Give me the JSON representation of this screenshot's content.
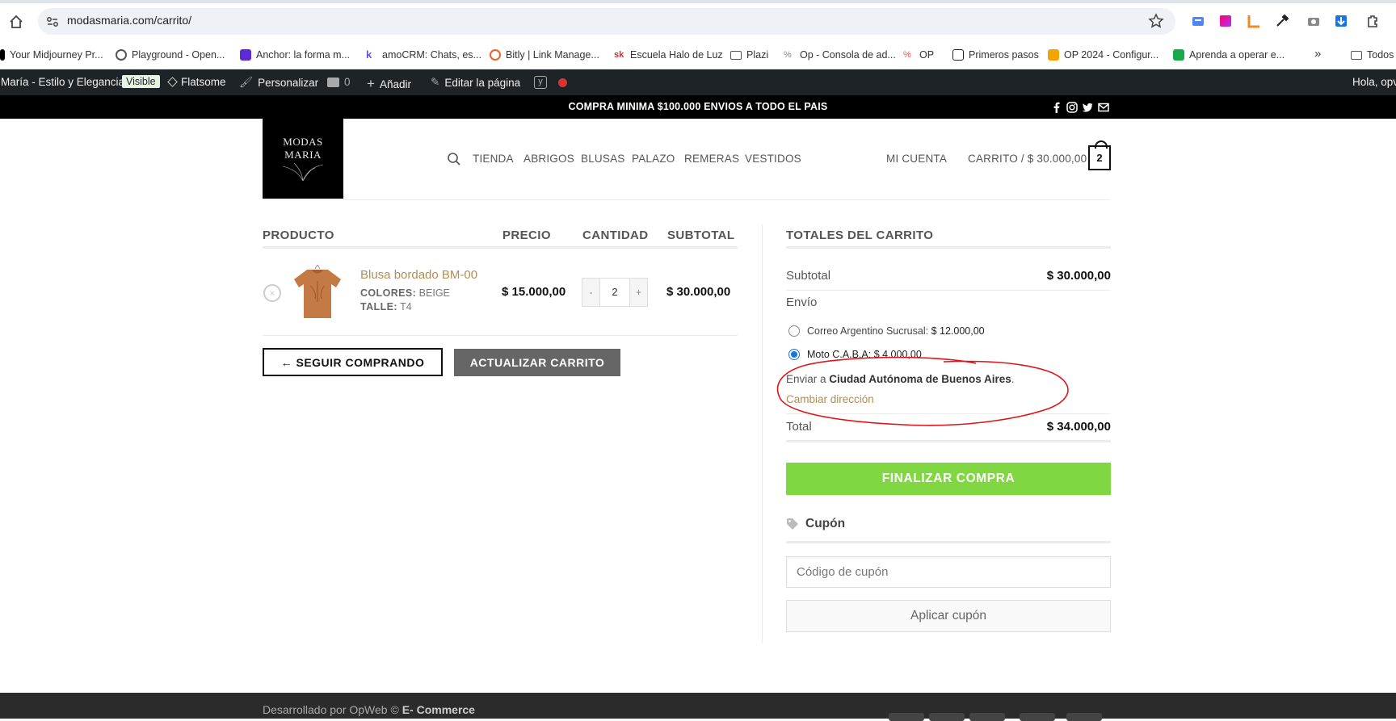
{
  "browser": {
    "url": "modasmaria.com/carrito/",
    "bookmarks": [
      {
        "label": "Your Midjourney Pr...",
        "color": "#000000"
      },
      {
        "label": "Playground - Open...",
        "color": "#555555"
      },
      {
        "label": "Anchor: la forma m...",
        "color": "#5b2bd6"
      },
      {
        "label": "amoCRM: Chats, es...",
        "color": "#6b4df0"
      },
      {
        "label": "Bitly | Link Manage...",
        "color": "#ee6123"
      },
      {
        "label": "Escuela Halo de Luz",
        "color": "#d32f2f"
      },
      {
        "label": "Plazi",
        "color": "#555555"
      },
      {
        "label": "Op - Consola de ad...",
        "color": "#888888"
      },
      {
        "label": "OP",
        "color": "#e0554d"
      },
      {
        "label": "Primeros pasos",
        "color": "#222222"
      },
      {
        "label": "OP 2024 - Configur...",
        "color": "#f4a300"
      },
      {
        "label": "Aprenda a operar e...",
        "color": "#1aa94a"
      }
    ],
    "bookmarks_overflow": "»",
    "all_bookmarks": "Todos"
  },
  "adminbar": {
    "site_name": "María - Estilo y Elegancia",
    "visible_badge": "Visible",
    "theme": "Flatsome",
    "customize": "Personalizar",
    "comments_count": "0",
    "add_new": "Añadir",
    "edit_page": "Editar la página",
    "greeting": "Hola, opv"
  },
  "topbar": {
    "message": "COMPRA MINIMA $100.000 ENVIOS A TODO EL PAIS"
  },
  "header": {
    "logo_line1": "MODAS",
    "logo_line2": "MARIA",
    "nav": [
      "TIENDA",
      "ABRIGOS",
      "BLUSAS",
      "PALAZO",
      "REMERAS",
      "VESTIDOS"
    ],
    "account": "MI CUENTA",
    "cart_label": "CARRITO / $ 30.000,00",
    "cart_count": "2"
  },
  "cart": {
    "headers": {
      "product": "PRODUCTO",
      "price": "PRECIO",
      "quantity": "CANTIDAD",
      "subtotal": "SUBTOTAL"
    },
    "item": {
      "name": "Blusa bordado BM-00",
      "colors_label": "COLORES:",
      "colors_value": "BEIGE",
      "size_label": "TALLE:",
      "size_value": "T4",
      "price": "$ 15.000,00",
      "quantity": "2",
      "minus": "-",
      "plus": "+",
      "subtotal": "$ 30.000,00",
      "remove": "×"
    },
    "continue_label": "← SEGUIR COMPRANDO",
    "update_label": "ACTUALIZAR CARRITO"
  },
  "totals": {
    "title": "TOTALES DEL CARRITO",
    "subtotal_label": "Subtotal",
    "subtotal_value": "$ 30.000,00",
    "shipping_label": "Envío",
    "options": [
      {
        "name": "Correo Argentino Sucrusal:",
        "price": "$ 12.000,00",
        "selected": false
      },
      {
        "name": "Moto C.A.B.A:",
        "price": "$ 4.000,00",
        "selected": true
      }
    ],
    "ship_to_prefix": "Enviar a",
    "ship_to_place": "Ciudad Autónoma de Buenos Aires",
    "ship_to_suffix": ".",
    "change_address": "Cambiar dirección",
    "total_label": "Total",
    "total_value": "$ 34.000,00",
    "checkout": "FINALIZAR COMPRA",
    "coupon_title": "Cupón",
    "coupon_placeholder": "Código de cupón",
    "coupon_apply": "Aplicar cupón"
  },
  "footer": {
    "prefix": "Desarrollado por OpWeb ©",
    "brand": "E- Commerce"
  },
  "colors": {
    "accent": "#b08d57",
    "checkout_green": "#81d742",
    "annotation_red": "#e0141a"
  }
}
